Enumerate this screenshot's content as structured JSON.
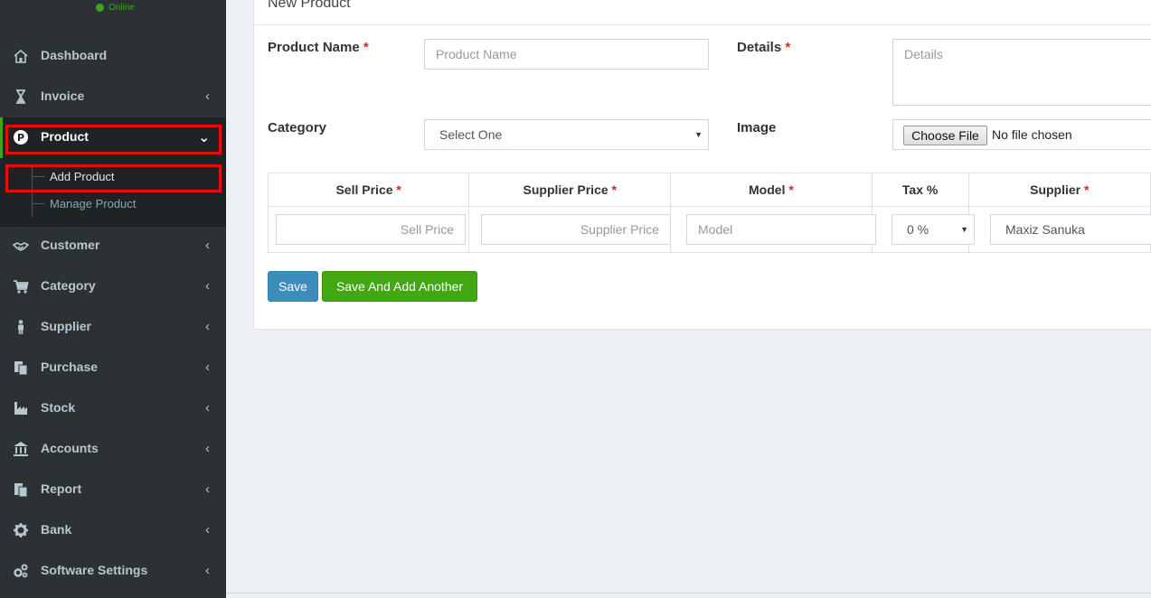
{
  "sidebar": {
    "status": "Online",
    "items": [
      {
        "label": "Dashboard",
        "icon": "home-icon"
      },
      {
        "label": "Invoice",
        "icon": "hourglass-icon"
      },
      {
        "label": "Product",
        "icon": "product-p-icon"
      },
      {
        "label": "Customer",
        "icon": "handshake-icon"
      },
      {
        "label": "Category",
        "icon": "cart-icon"
      },
      {
        "label": "Supplier",
        "icon": "person-icon"
      },
      {
        "label": "Purchase",
        "icon": "documents-icon"
      },
      {
        "label": "Stock",
        "icon": "factory-icon"
      },
      {
        "label": "Accounts",
        "icon": "bank-building-icon"
      },
      {
        "label": "Report",
        "icon": "report-icon"
      },
      {
        "label": "Bank",
        "icon": "gear-icon"
      },
      {
        "label": "Software Settings",
        "icon": "gears-icon"
      }
    ],
    "submenu": [
      "Add Product",
      "Manage Product"
    ]
  },
  "form": {
    "title": "New Product",
    "required_mark": "*",
    "product_name": {
      "label": "Product Name",
      "placeholder": "Product Name"
    },
    "details": {
      "label": "Details",
      "placeholder": "Details"
    },
    "category": {
      "label": "Category",
      "value": "Select One"
    },
    "image": {
      "label": "Image",
      "button": "Choose File",
      "status": "No file chosen"
    },
    "table": {
      "headers": [
        "Sell Price",
        "Supplier Price",
        "Model",
        "Tax %",
        "Supplier"
      ],
      "sell_price_placeholder": "Sell Price",
      "supplier_price_placeholder": "Supplier Price",
      "model_placeholder": "Model",
      "tax_value": "0 %",
      "supplier_value": "Maxiz Sanuka"
    },
    "buttons": {
      "save": "Save",
      "save_add": "Save And Add Another"
    }
  },
  "colors": {
    "sidebar_bg": "#2c3134",
    "accent_green": "#3fa51c",
    "highlight_red": "#e80d0d",
    "save_blue": "#3c8dbc",
    "save_add_green": "#42a713"
  }
}
